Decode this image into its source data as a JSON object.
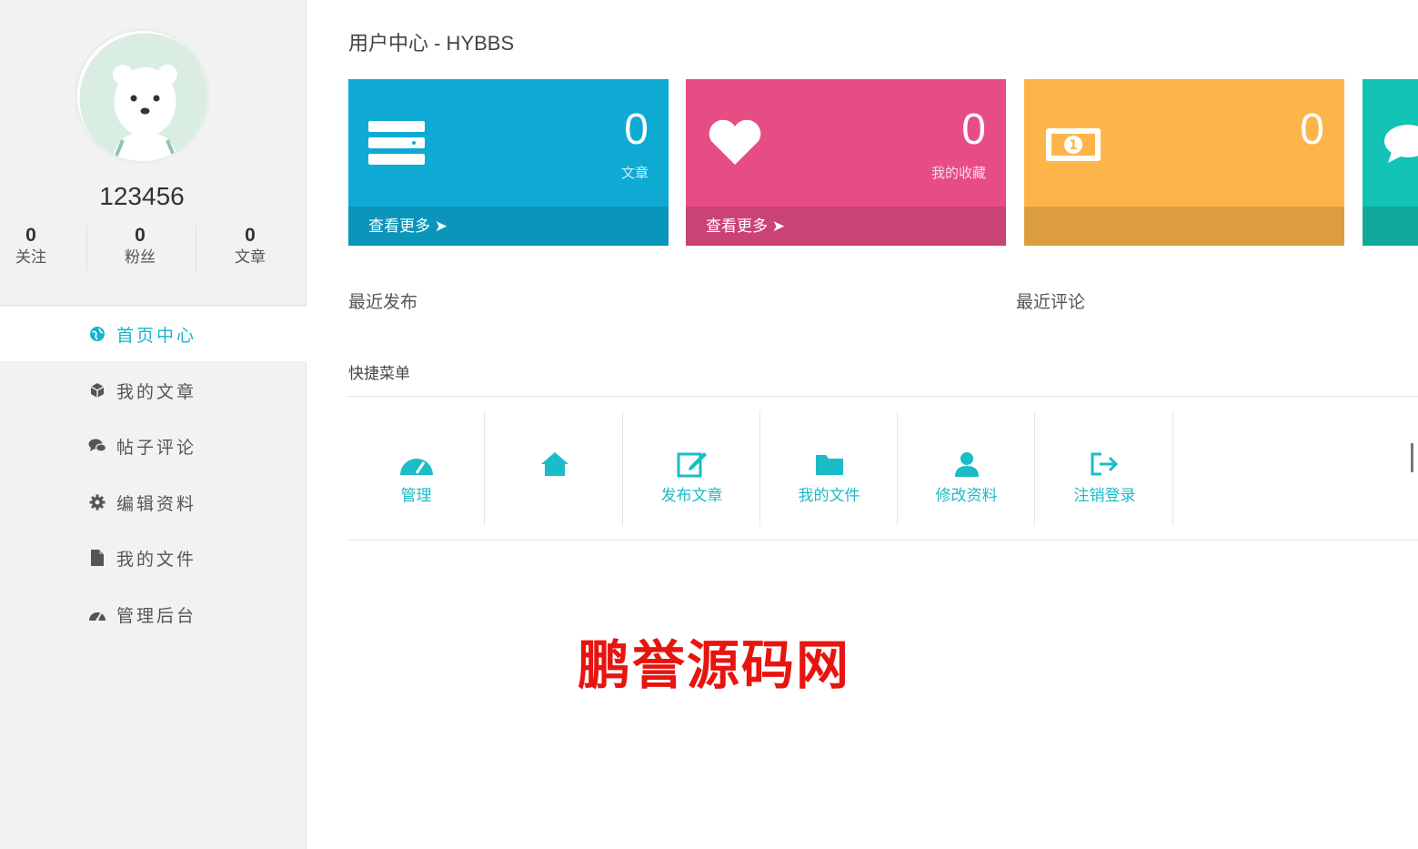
{
  "user": {
    "username": "123456",
    "stats": [
      {
        "value": "0",
        "label": "关注"
      },
      {
        "value": "0",
        "label": "粉丝"
      },
      {
        "value": "0",
        "label": "文章"
      }
    ]
  },
  "sidebar": {
    "items": [
      {
        "label": "首页中心",
        "icon": "globe-icon",
        "active": true
      },
      {
        "label": "我的文章",
        "icon": "cube-icon",
        "active": false
      },
      {
        "label": "帖子评论",
        "icon": "comments-icon",
        "active": false
      },
      {
        "label": "编辑资料",
        "icon": "gear-icon",
        "active": false
      },
      {
        "label": "我的文件",
        "icon": "file-icon",
        "active": false
      },
      {
        "label": "管理后台",
        "icon": "dashboard-icon",
        "active": false
      }
    ]
  },
  "main": {
    "title": "用户中心 - HYBBS",
    "cards": [
      {
        "value": "0",
        "label": "文章",
        "more": "查看更多",
        "color": "#0eaad4",
        "icon": "server-icon"
      },
      {
        "value": "0",
        "label": "我的收藏",
        "more": "查看更多",
        "color": "#e74d85",
        "icon": "heart-icon"
      },
      {
        "value": "0",
        "label": "",
        "more": "",
        "color": "#fdb54a",
        "icon": "money-icon"
      },
      {
        "value": "",
        "label": "",
        "more": "",
        "color": "#12c2b4",
        "icon": "comments-icon"
      }
    ],
    "recent_posts_label": "最近发布",
    "recent_comments_label": "最近评论",
    "quick_menu_title": "快捷菜单",
    "quick_menu": [
      {
        "label": "管理",
        "icon": "dashboard-icon"
      },
      {
        "label": "",
        "icon": "home-icon"
      },
      {
        "label": "发布文章",
        "icon": "edit-icon"
      },
      {
        "label": "我的文件",
        "icon": "folder-icon"
      },
      {
        "label": "修改资料",
        "icon": "user-icon"
      },
      {
        "label": "注销登录",
        "icon": "logout-icon"
      }
    ]
  },
  "watermark": "鹏誉源码网",
  "colors": {
    "accent": "#16b3c9",
    "sidebar_bg": "#f2f2f2",
    "watermark": "#e8140f"
  }
}
